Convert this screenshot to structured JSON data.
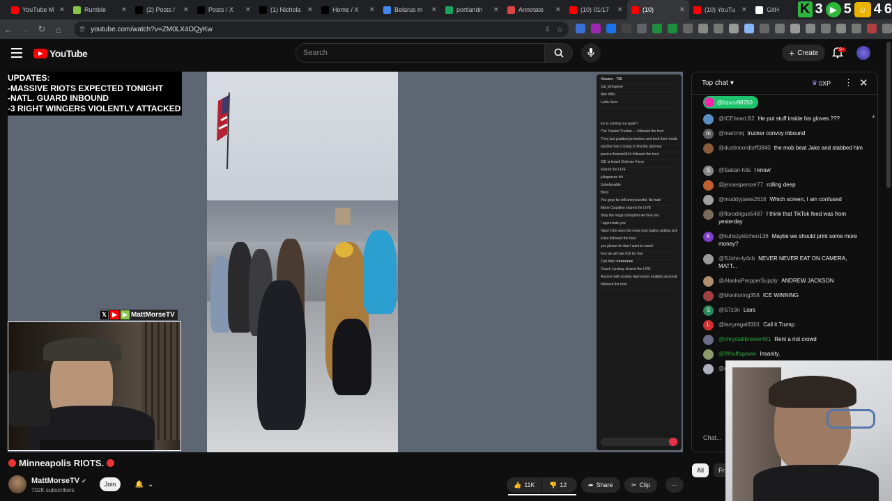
{
  "browser": {
    "tabs": [
      {
        "title": "YouTube M",
        "fav_color": "#ff0000",
        "active": false
      },
      {
        "title": "Rumble",
        "fav_color": "#85c742",
        "active": false
      },
      {
        "title": "(2) Posts /",
        "fav_color": "#000000",
        "active": false
      },
      {
        "title": "Posts / X",
        "fav_color": "#000000",
        "active": false
      },
      {
        "title": "(1) Nichola",
        "fav_color": "#000000",
        "active": false
      },
      {
        "title": "Home / X",
        "fav_color": "#000000",
        "active": false
      },
      {
        "title": "Belarus m",
        "fav_color": "#4285f4",
        "active": false
      },
      {
        "title": "portlandn",
        "fav_color": "#1aa260",
        "active": false
      },
      {
        "title": "Annotate",
        "fav_color": "#d44",
        "active": false
      },
      {
        "title": "(10) 01/17",
        "fav_color": "#ff0000",
        "active": false
      },
      {
        "title": "(10)",
        "fav_color": "#ff0000",
        "active": true
      },
      {
        "title": "(10) YouTu",
        "fav_color": "#ff0000",
        "active": false
      },
      {
        "title": "GitH",
        "fav_color": "#ffffff",
        "active": false
      }
    ],
    "overlay_digits": [
      "3",
      "5",
      "4",
      "6"
    ],
    "url": "youtube.com/watch?v=ZM0LX4OQyKw"
  },
  "youtube": {
    "logo_text": "YouTube",
    "search_placeholder": "Search",
    "create_label": "Create",
    "notif_badge": "9+"
  },
  "video": {
    "updates_text": "UPDATES:\n-MASSIVE RIOTS EXPECTED TONIGHT\n-NATL. GUARD INBOUND\n-3 RIGHT WINGERS VIOLENTLY ATTACKED",
    "pip_handle": "MattMorseTV",
    "title": "Minneapolis RIOTS.",
    "channel": "MattMorseTV",
    "subscribers": "702K subscribers",
    "join_label": "Join",
    "likes": "11K",
    "dislikes": "12",
    "share_label": "Share",
    "clip_label": "Clip"
  },
  "chat": {
    "header": "Top chat",
    "xp_label": "0XP",
    "pinned_user": "@bzxcv98760",
    "messages": [
      {
        "author": "@ICEheart.B2",
        "text": "He put stuff inside his gloves ???",
        "av": "#5a8ec2",
        "green": false,
        "lines": 1
      },
      {
        "author": "@marcnnj",
        "text": "trucker convoy inbound",
        "av": "#606060",
        "green": false,
        "lines": 1,
        "initial": "m"
      },
      {
        "author": "@dustinnordorff3840",
        "text": "the mob beat Jake and stabbed him",
        "av": "#8a5a3a",
        "green": false,
        "lines": 2
      },
      {
        "author": "@Sakari-h3s",
        "text": "I know'",
        "av": "#888888",
        "green": false,
        "lines": 1,
        "initial": "S"
      },
      {
        "author": "@jessespencer77",
        "text": "rolling deep",
        "av": "#c06030",
        "green": false,
        "lines": 1
      },
      {
        "author": "@muddypaws2616",
        "text": "Which screen, I am confused",
        "av": "#a0a0a0",
        "green": false,
        "lines": 1
      },
      {
        "author": "@florodrigue5487",
        "text": "I think that TikTok feed was from yesterday",
        "av": "#7a6a5a",
        "green": false,
        "lines": 2
      },
      {
        "author": "@kuhszykitchen136",
        "text": "Maybe we should print some more money?",
        "av": "#7b3fc4",
        "green": false,
        "lines": 2,
        "initial": "K"
      },
      {
        "author": "@SJohn-ly4cb",
        "text": "NEVER NEVER EAT ON CAMERA, MATT...",
        "av": "#9a9a9a",
        "green": false,
        "lines": 2
      },
      {
        "author": "@AlaskaPrepperSupply",
        "text": "ANDREW JACKSON",
        "av": "#b09070",
        "green": false,
        "lines": 1
      },
      {
        "author": "@Monitoring358",
        "text": "ICE WINNING",
        "av": "#a04040",
        "green": false,
        "lines": 1
      },
      {
        "author": "@S7z3n",
        "text": "Liars",
        "av": "#2a8a5a",
        "green": false,
        "lines": 1,
        "initial": "S"
      },
      {
        "author": "@larryregal8301",
        "text": "Call it Trump",
        "av": "#d03030",
        "green": false,
        "lines": 1,
        "initial": "L"
      },
      {
        "author": "@chrystallbrewer401",
        "text": "Rent a riot crowd",
        "av": "#6a6a8a",
        "green": true,
        "lines": 1
      },
      {
        "author": "@Whuffagowie",
        "text": "Insanity.",
        "av": "#8a9a6a",
        "green": true,
        "lines": 1
      },
      {
        "author": "@avendb7",
        "text": "Troops leaving Qatar to come to MP",
        "av": "#b0b0c0",
        "green": false,
        "lines": 1
      }
    ],
    "input_placeholder": "Chat...",
    "filter_all": "All",
    "filter_fr": "Fr"
  }
}
